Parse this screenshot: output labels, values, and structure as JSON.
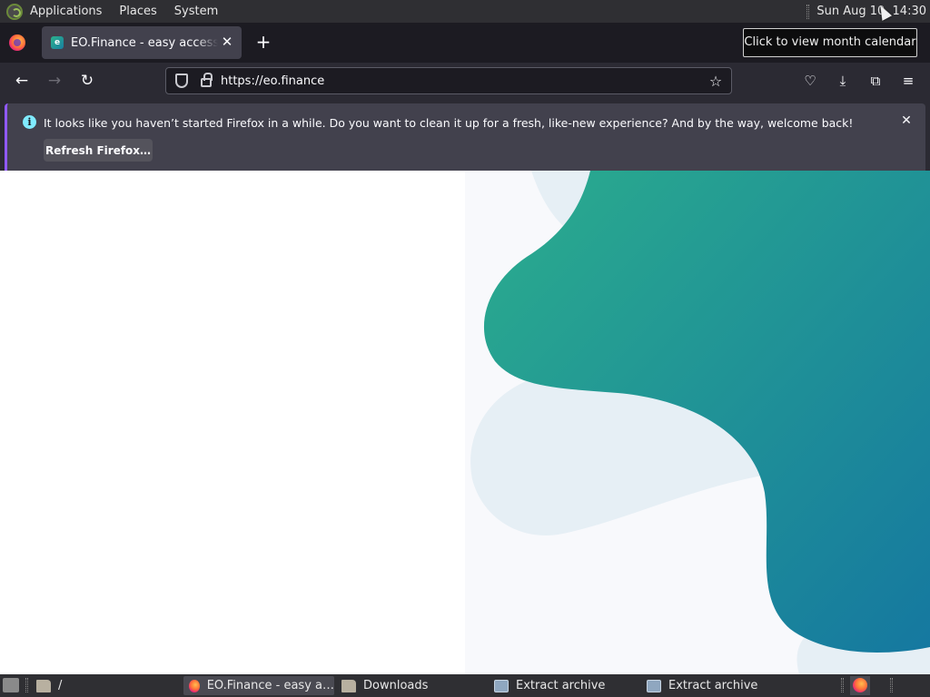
{
  "top_panel": {
    "menus": [
      "Applications",
      "Places",
      "System"
    ],
    "clock": "Sun Aug 10, 14:30"
  },
  "browser": {
    "tab": {
      "title": "EO.Finance - easy access to",
      "favicon_letter": "e"
    },
    "tooltip": "Click to view month calendar",
    "url": "https://eo.finance",
    "notification": {
      "message": "It looks like you haven’t started Firefox in a while. Do you want to clean it up for a fresh, like-new experience? And by the way, welcome back!",
      "button_label": "Refresh Firefox…"
    }
  },
  "taskbar": {
    "path": "/",
    "tasks": [
      {
        "label": "EO.Finance - easy a…",
        "icon": "firefox-icon",
        "active": true
      },
      {
        "label": "Downloads",
        "icon": "folder-icon",
        "active": false
      },
      {
        "label": "Extract archive",
        "icon": "archive-icon",
        "active": false
      },
      {
        "label": "Extract archive",
        "icon": "archive-icon",
        "active": false
      }
    ]
  },
  "colors": {
    "blob_gradient_start": "#2bad8d",
    "blob_gradient_end": "#1578a0",
    "firefox_accent": "#9059ff"
  }
}
